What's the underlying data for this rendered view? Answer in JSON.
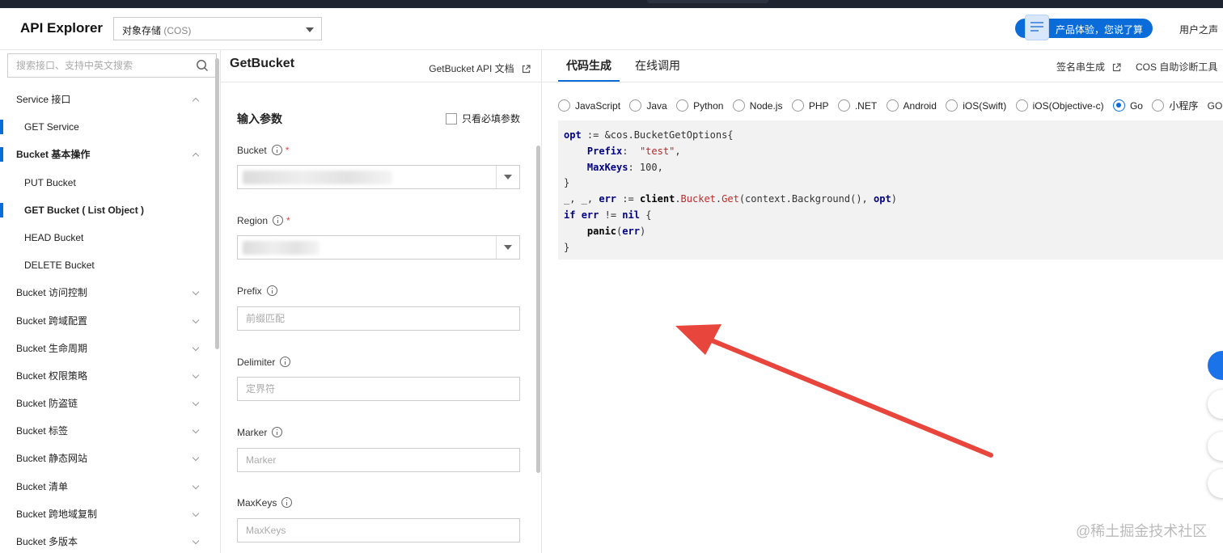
{
  "header": {
    "app_title": "API Explorer",
    "product_select": {
      "value": "对象存储",
      "hint": "(COS)"
    },
    "feedback_button": "产品体验，您说了算",
    "user_voice": "用户之声"
  },
  "sidebar": {
    "search_placeholder": "搜索接口、支持中英文搜索",
    "items": [
      {
        "label": "Service 接口",
        "level": "group",
        "expanded": true
      },
      {
        "label": "GET Service",
        "level": "child"
      },
      {
        "label": "Bucket 基本操作",
        "level": "group",
        "expanded": true,
        "bold": true
      },
      {
        "label": "PUT Bucket",
        "level": "child"
      },
      {
        "label": "GET Bucket ( List Object )",
        "level": "child",
        "selected": true
      },
      {
        "label": "HEAD Bucket",
        "level": "child"
      },
      {
        "label": "DELETE Bucket",
        "level": "child"
      },
      {
        "label": "Bucket 访问控制",
        "level": "group"
      },
      {
        "label": "Bucket 跨域配置",
        "level": "group"
      },
      {
        "label": "Bucket 生命周期",
        "level": "group"
      },
      {
        "label": "Bucket 权限策略",
        "level": "group"
      },
      {
        "label": "Bucket 防盗链",
        "level": "group"
      },
      {
        "label": "Bucket 标签",
        "level": "group"
      },
      {
        "label": "Bucket 静态网站",
        "level": "group"
      },
      {
        "label": "Bucket 清单",
        "level": "group"
      },
      {
        "label": "Bucket 跨地域复制",
        "level": "group"
      },
      {
        "label": "Bucket 多版本",
        "level": "group"
      }
    ]
  },
  "params": {
    "api_name": "GetBucket",
    "doc_link": "GetBucket API 文档",
    "section_title": "输入参数",
    "required_only": "只看必填参数",
    "fields": {
      "bucket": {
        "label": "Bucket",
        "required": true
      },
      "region": {
        "label": "Region",
        "required": true
      },
      "prefix": {
        "label": "Prefix",
        "placeholder": "前缀匹配"
      },
      "delimiter": {
        "label": "Delimiter",
        "placeholder": "定界符"
      },
      "marker": {
        "label": "Marker",
        "placeholder": "Marker"
      },
      "maxkeys": {
        "label": "MaxKeys",
        "placeholder": "MaxKeys"
      }
    }
  },
  "code_panel": {
    "tabs": [
      {
        "label": "代码生成",
        "active": true
      },
      {
        "label": "在线调用",
        "active": false
      }
    ],
    "tools": {
      "signature": "签名串生成",
      "diagnose": "COS 自助诊断工具"
    },
    "languages": [
      {
        "label": "JavaScript",
        "selected": false
      },
      {
        "label": "Java",
        "selected": false
      },
      {
        "label": "Python",
        "selected": false
      },
      {
        "label": "Node.js",
        "selected": false
      },
      {
        "label": "PHP",
        "selected": false
      },
      {
        "label": ".NET",
        "selected": false
      },
      {
        "label": "Android",
        "selected": false
      },
      {
        "label": "iOS(Swift)",
        "selected": false
      },
      {
        "label": "iOS(Objective-c)",
        "selected": false
      },
      {
        "label": "Go",
        "selected": true
      },
      {
        "label": "小程序",
        "selected": false
      }
    ],
    "sdk_doc": "GO SDK使用",
    "code_lines": [
      "opt := &cos.BucketGetOptions{",
      "    Prefix:  \"test\",",
      "    MaxKeys: 100,",
      "}",
      "_, _, err := client.Bucket.Get(context.Background(), opt)",
      "if err != nil {",
      "    panic(err)",
      "}"
    ]
  },
  "colors": {
    "accent": "#0a6cd8",
    "annotation_arrow": "#e8453c",
    "required_star": "#e54545"
  },
  "watermark": "@稀土掘金技术社区"
}
